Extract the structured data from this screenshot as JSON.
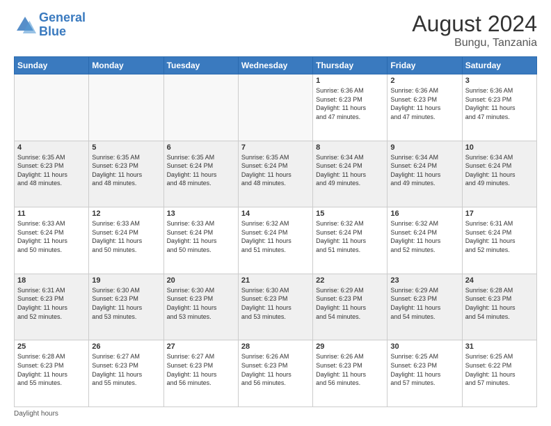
{
  "header": {
    "logo_line1": "General",
    "logo_line2": "Blue",
    "month_year": "August 2024",
    "location": "Bungu, Tanzania"
  },
  "days_of_week": [
    "Sunday",
    "Monday",
    "Tuesday",
    "Wednesday",
    "Thursday",
    "Friday",
    "Saturday"
  ],
  "footer": {
    "note": "Daylight hours"
  },
  "weeks": [
    [
      {
        "day": "",
        "info": ""
      },
      {
        "day": "",
        "info": ""
      },
      {
        "day": "",
        "info": ""
      },
      {
        "day": "",
        "info": ""
      },
      {
        "day": "1",
        "info": "Sunrise: 6:36 AM\nSunset: 6:23 PM\nDaylight: 11 hours\nand 47 minutes."
      },
      {
        "day": "2",
        "info": "Sunrise: 6:36 AM\nSunset: 6:23 PM\nDaylight: 11 hours\nand 47 minutes."
      },
      {
        "day": "3",
        "info": "Sunrise: 6:36 AM\nSunset: 6:23 PM\nDaylight: 11 hours\nand 47 minutes."
      }
    ],
    [
      {
        "day": "4",
        "info": "Sunrise: 6:35 AM\nSunset: 6:23 PM\nDaylight: 11 hours\nand 48 minutes."
      },
      {
        "day": "5",
        "info": "Sunrise: 6:35 AM\nSunset: 6:23 PM\nDaylight: 11 hours\nand 48 minutes."
      },
      {
        "day": "6",
        "info": "Sunrise: 6:35 AM\nSunset: 6:24 PM\nDaylight: 11 hours\nand 48 minutes."
      },
      {
        "day": "7",
        "info": "Sunrise: 6:35 AM\nSunset: 6:24 PM\nDaylight: 11 hours\nand 48 minutes."
      },
      {
        "day": "8",
        "info": "Sunrise: 6:34 AM\nSunset: 6:24 PM\nDaylight: 11 hours\nand 49 minutes."
      },
      {
        "day": "9",
        "info": "Sunrise: 6:34 AM\nSunset: 6:24 PM\nDaylight: 11 hours\nand 49 minutes."
      },
      {
        "day": "10",
        "info": "Sunrise: 6:34 AM\nSunset: 6:24 PM\nDaylight: 11 hours\nand 49 minutes."
      }
    ],
    [
      {
        "day": "11",
        "info": "Sunrise: 6:33 AM\nSunset: 6:24 PM\nDaylight: 11 hours\nand 50 minutes."
      },
      {
        "day": "12",
        "info": "Sunrise: 6:33 AM\nSunset: 6:24 PM\nDaylight: 11 hours\nand 50 minutes."
      },
      {
        "day": "13",
        "info": "Sunrise: 6:33 AM\nSunset: 6:24 PM\nDaylight: 11 hours\nand 50 minutes."
      },
      {
        "day": "14",
        "info": "Sunrise: 6:32 AM\nSunset: 6:24 PM\nDaylight: 11 hours\nand 51 minutes."
      },
      {
        "day": "15",
        "info": "Sunrise: 6:32 AM\nSunset: 6:24 PM\nDaylight: 11 hours\nand 51 minutes."
      },
      {
        "day": "16",
        "info": "Sunrise: 6:32 AM\nSunset: 6:24 PM\nDaylight: 11 hours\nand 52 minutes."
      },
      {
        "day": "17",
        "info": "Sunrise: 6:31 AM\nSunset: 6:24 PM\nDaylight: 11 hours\nand 52 minutes."
      }
    ],
    [
      {
        "day": "18",
        "info": "Sunrise: 6:31 AM\nSunset: 6:23 PM\nDaylight: 11 hours\nand 52 minutes."
      },
      {
        "day": "19",
        "info": "Sunrise: 6:30 AM\nSunset: 6:23 PM\nDaylight: 11 hours\nand 53 minutes."
      },
      {
        "day": "20",
        "info": "Sunrise: 6:30 AM\nSunset: 6:23 PM\nDaylight: 11 hours\nand 53 minutes."
      },
      {
        "day": "21",
        "info": "Sunrise: 6:30 AM\nSunset: 6:23 PM\nDaylight: 11 hours\nand 53 minutes."
      },
      {
        "day": "22",
        "info": "Sunrise: 6:29 AM\nSunset: 6:23 PM\nDaylight: 11 hours\nand 54 minutes."
      },
      {
        "day": "23",
        "info": "Sunrise: 6:29 AM\nSunset: 6:23 PM\nDaylight: 11 hours\nand 54 minutes."
      },
      {
        "day": "24",
        "info": "Sunrise: 6:28 AM\nSunset: 6:23 PM\nDaylight: 11 hours\nand 54 minutes."
      }
    ],
    [
      {
        "day": "25",
        "info": "Sunrise: 6:28 AM\nSunset: 6:23 PM\nDaylight: 11 hours\nand 55 minutes."
      },
      {
        "day": "26",
        "info": "Sunrise: 6:27 AM\nSunset: 6:23 PM\nDaylight: 11 hours\nand 55 minutes."
      },
      {
        "day": "27",
        "info": "Sunrise: 6:27 AM\nSunset: 6:23 PM\nDaylight: 11 hours\nand 56 minutes."
      },
      {
        "day": "28",
        "info": "Sunrise: 6:26 AM\nSunset: 6:23 PM\nDaylight: 11 hours\nand 56 minutes."
      },
      {
        "day": "29",
        "info": "Sunrise: 6:26 AM\nSunset: 6:23 PM\nDaylight: 11 hours\nand 56 minutes."
      },
      {
        "day": "30",
        "info": "Sunrise: 6:25 AM\nSunset: 6:23 PM\nDaylight: 11 hours\nand 57 minutes."
      },
      {
        "day": "31",
        "info": "Sunrise: 6:25 AM\nSunset: 6:22 PM\nDaylight: 11 hours\nand 57 minutes."
      }
    ]
  ]
}
